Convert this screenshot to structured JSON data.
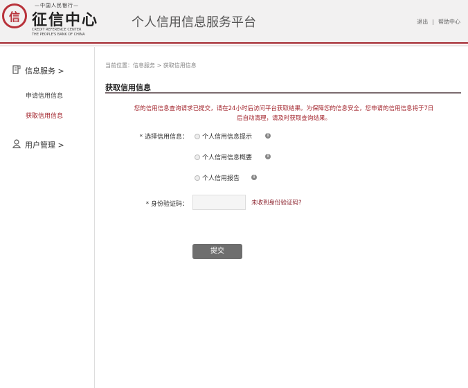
{
  "header": {
    "logo_top": "—中国人民银行—",
    "logo_main": "征信中心",
    "logo_en_1": "CREDIT REFERENCE CENTER",
    "logo_en_2": "THE PEOPLE'S BANK OF CHINA",
    "title": "个人信用信息服务平台",
    "logout": "退出",
    "separator": "|",
    "help": "帮助中心"
  },
  "sidebar": {
    "section1": "信息服务 >",
    "items": [
      "申请信用信息",
      "获取信用信息"
    ],
    "section2": "用户管理 >"
  },
  "main": {
    "breadcrumb": "当前位置：信息服务 > 获取信用信息",
    "heading": "获取信用信息",
    "notice_1": "您的信用信息查询请求已提交，请在24小时后访问平台获取结果。为保障您的信息安全，您申请的信用信息将于7日",
    "notice_2": "后自动清理，请及时获取查询结果。",
    "select_label": "* 选择信用信息：",
    "options": [
      "个人信用信息提示",
      "个人信用信息概要",
      "个人信用报告"
    ],
    "code_label": "* 身份验证码：",
    "code_value": "",
    "code_link": "未收到身份验证码?",
    "submit": "提交"
  }
}
